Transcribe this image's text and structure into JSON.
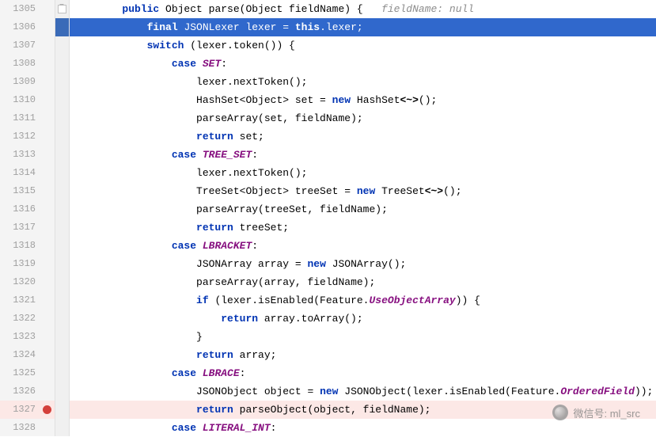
{
  "gutter": {
    "start": 1305,
    "end": 1328,
    "selected": 1306,
    "error": 1327,
    "fold": 1305
  },
  "code": {
    "lines": [
      {
        "n": 1305,
        "indent": 2,
        "tokens": [
          {
            "t": "public ",
            "c": "kw"
          },
          {
            "t": "Object ",
            "c": "ty"
          },
          {
            "t": "parse(Object fieldName) {   ",
            "c": ""
          },
          {
            "t": "fieldName: null",
            "c": "cmt"
          }
        ]
      },
      {
        "n": 1306,
        "indent": 3,
        "sel": true,
        "tokens": [
          {
            "t": "final ",
            "c": "kw-f"
          },
          {
            "t": "JSONLexer lexer = ",
            "c": ""
          },
          {
            "t": "this",
            "c": "kw-f"
          },
          {
            "t": ".",
            "c": ""
          },
          {
            "t": "lexer",
            "c": ""
          },
          {
            "t": ";",
            "c": ""
          }
        ]
      },
      {
        "n": 1307,
        "indent": 3,
        "tokens": [
          {
            "t": "switch ",
            "c": "kw"
          },
          {
            "t": "(lexer.token()) {",
            "c": ""
          }
        ]
      },
      {
        "n": 1308,
        "indent": 4,
        "tokens": [
          {
            "t": "case ",
            "c": "kw"
          },
          {
            "t": "SET",
            "c": "fld"
          },
          {
            "t": ":",
            "c": ""
          }
        ]
      },
      {
        "n": 1309,
        "indent": 5,
        "tokens": [
          {
            "t": "lexer.nextToken();",
            "c": ""
          }
        ]
      },
      {
        "n": 1310,
        "indent": 5,
        "tokens": [
          {
            "t": "HashSet<Object> set = ",
            "c": ""
          },
          {
            "t": "new ",
            "c": "kw"
          },
          {
            "t": "HashSet",
            "c": ""
          },
          {
            "t": "<~>",
            "c": "gen"
          },
          {
            "t": "();",
            "c": ""
          }
        ]
      },
      {
        "n": 1311,
        "indent": 5,
        "tokens": [
          {
            "t": "parseArray(set, fieldName);",
            "c": ""
          }
        ]
      },
      {
        "n": 1312,
        "indent": 5,
        "tokens": [
          {
            "t": "return ",
            "c": "kw"
          },
          {
            "t": "set;",
            "c": ""
          }
        ]
      },
      {
        "n": 1313,
        "indent": 4,
        "tokens": [
          {
            "t": "case ",
            "c": "kw"
          },
          {
            "t": "TREE_SET",
            "c": "fld"
          },
          {
            "t": ":",
            "c": ""
          }
        ]
      },
      {
        "n": 1314,
        "indent": 5,
        "tokens": [
          {
            "t": "lexer.nextToken();",
            "c": ""
          }
        ]
      },
      {
        "n": 1315,
        "indent": 5,
        "tokens": [
          {
            "t": "TreeSet<Object> treeSet = ",
            "c": ""
          },
          {
            "t": "new ",
            "c": "kw"
          },
          {
            "t": "TreeSet",
            "c": ""
          },
          {
            "t": "<~>",
            "c": "gen"
          },
          {
            "t": "();",
            "c": ""
          }
        ]
      },
      {
        "n": 1316,
        "indent": 5,
        "tokens": [
          {
            "t": "parseArray(treeSet, fieldName);",
            "c": ""
          }
        ]
      },
      {
        "n": 1317,
        "indent": 5,
        "tokens": [
          {
            "t": "return ",
            "c": "kw"
          },
          {
            "t": "treeSet;",
            "c": ""
          }
        ]
      },
      {
        "n": 1318,
        "indent": 4,
        "tokens": [
          {
            "t": "case ",
            "c": "kw"
          },
          {
            "t": "LBRACKET",
            "c": "fld"
          },
          {
            "t": ":",
            "c": ""
          }
        ]
      },
      {
        "n": 1319,
        "indent": 5,
        "tokens": [
          {
            "t": "JSONArray array = ",
            "c": ""
          },
          {
            "t": "new ",
            "c": "kw"
          },
          {
            "t": "JSONArray();",
            "c": ""
          }
        ]
      },
      {
        "n": 1320,
        "indent": 5,
        "tokens": [
          {
            "t": "parseArray(array, fieldName);",
            "c": ""
          }
        ]
      },
      {
        "n": 1321,
        "indent": 5,
        "tokens": [
          {
            "t": "if ",
            "c": "kw"
          },
          {
            "t": "(lexer.isEnabled(Feature.",
            "c": ""
          },
          {
            "t": "UseObjectArray",
            "c": "fld"
          },
          {
            "t": ")) {",
            "c": ""
          }
        ]
      },
      {
        "n": 1322,
        "indent": 6,
        "tokens": [
          {
            "t": "return ",
            "c": "kw"
          },
          {
            "t": "array.toArray();",
            "c": ""
          }
        ]
      },
      {
        "n": 1323,
        "indent": 5,
        "tokens": [
          {
            "t": "}",
            "c": ""
          }
        ]
      },
      {
        "n": 1324,
        "indent": 5,
        "tokens": [
          {
            "t": "return ",
            "c": "kw"
          },
          {
            "t": "array;",
            "c": ""
          }
        ]
      },
      {
        "n": 1325,
        "indent": 4,
        "tokens": [
          {
            "t": "case ",
            "c": "kw"
          },
          {
            "t": "LBRACE",
            "c": "fld"
          },
          {
            "t": ":",
            "c": ""
          }
        ]
      },
      {
        "n": 1326,
        "indent": 5,
        "tokens": [
          {
            "t": "JSONObject object = ",
            "c": ""
          },
          {
            "t": "new ",
            "c": "kw"
          },
          {
            "t": "JSONObject(lexer.isEnabled(Feature.",
            "c": ""
          },
          {
            "t": "OrderedField",
            "c": "fld"
          },
          {
            "t": "));",
            "c": ""
          }
        ]
      },
      {
        "n": 1327,
        "indent": 5,
        "err": true,
        "tokens": [
          {
            "t": "return ",
            "c": "kw"
          },
          {
            "t": "parseObject(object, fieldName);",
            "c": ""
          }
        ]
      },
      {
        "n": 1328,
        "indent": 4,
        "tokens": [
          {
            "t": "case ",
            "c": "kw"
          },
          {
            "t": "LITERAL_INT",
            "c": "fld"
          },
          {
            "t": ":",
            "c": ""
          }
        ]
      }
    ]
  },
  "watermark": {
    "text": "微信号: ml_src"
  }
}
